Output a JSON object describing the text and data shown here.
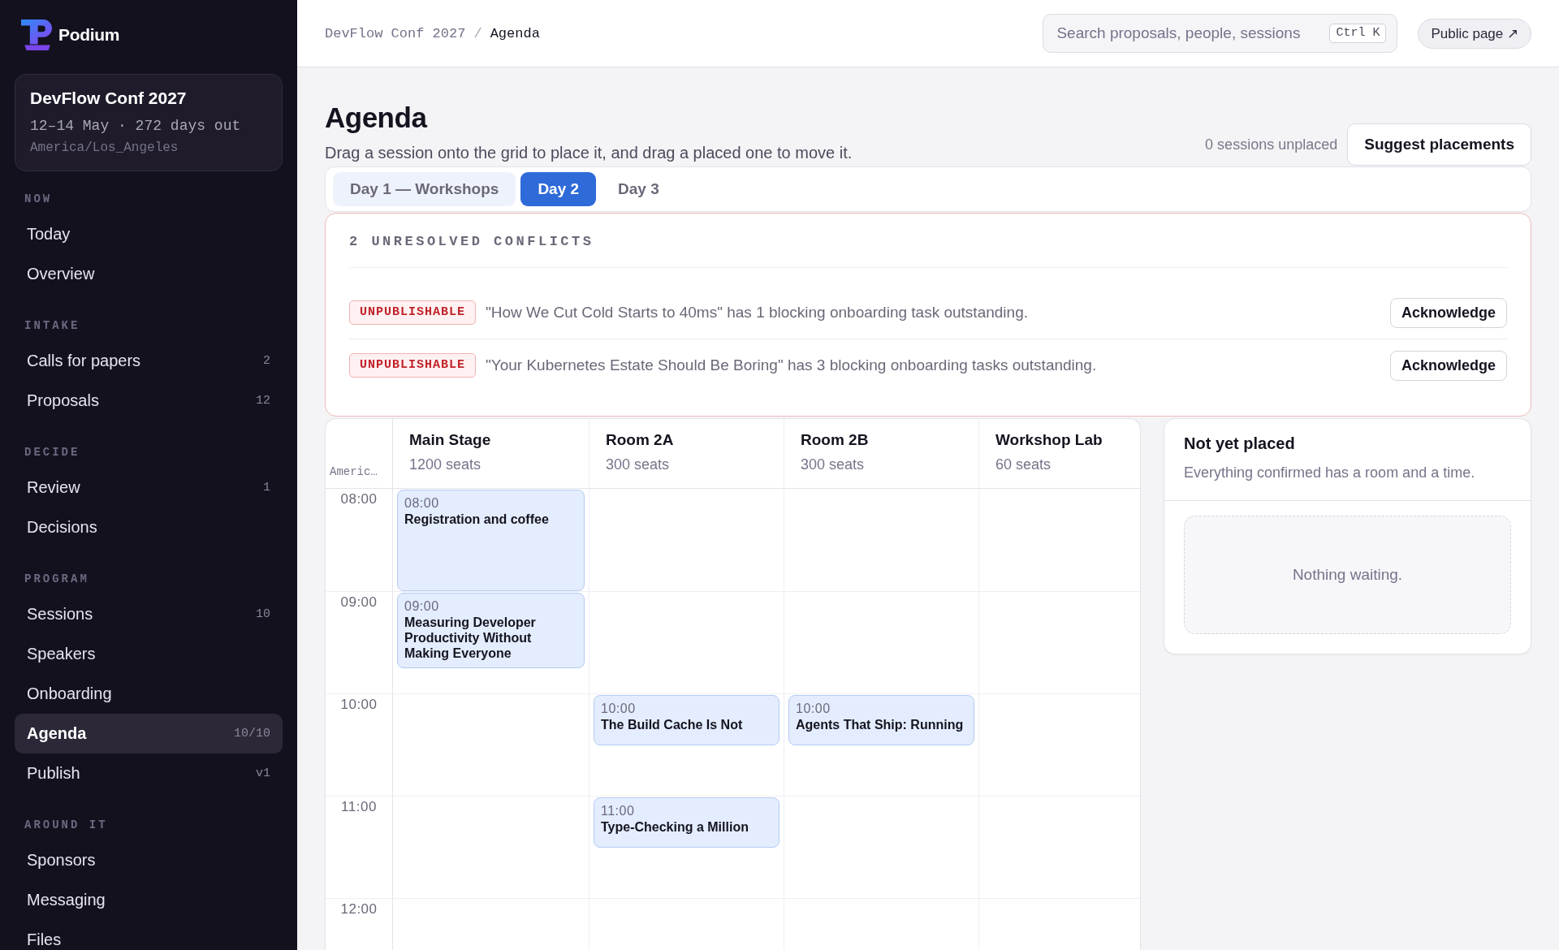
{
  "brand": {
    "name": "Podium"
  },
  "event": {
    "name": "DevFlow Conf 2027",
    "dates": "12–14 May · 272 days out",
    "timezone": "America/Los_Angeles"
  },
  "sidebar": {
    "sections": [
      {
        "title": "NOW",
        "items": [
          {
            "label": "Today",
            "selected": false
          },
          {
            "label": "Overview",
            "selected": false
          }
        ]
      },
      {
        "title": "INTAKE",
        "items": [
          {
            "label": "Calls for papers",
            "count": "2",
            "selected": false
          },
          {
            "label": "Proposals",
            "count": "12",
            "selected": false
          }
        ]
      },
      {
        "title": "DECIDE",
        "items": [
          {
            "label": "Review",
            "count": "1",
            "selected": false
          },
          {
            "label": "Decisions",
            "selected": false
          }
        ]
      },
      {
        "title": "PROGRAM",
        "items": [
          {
            "label": "Sessions",
            "count": "10",
            "selected": false
          },
          {
            "label": "Speakers",
            "selected": false
          },
          {
            "label": "Onboarding",
            "selected": false
          },
          {
            "label": "Agenda",
            "count": "10/10",
            "selected": true
          },
          {
            "label": "Publish",
            "count": "v1",
            "selected": false
          }
        ]
      },
      {
        "title": "AROUND IT",
        "items": [
          {
            "label": "Sponsors",
            "selected": false
          },
          {
            "label": "Messaging",
            "selected": false
          },
          {
            "label": "Files",
            "selected": false
          }
        ]
      }
    ]
  },
  "topbar": {
    "breadcrumb": [
      {
        "label": "DevFlow Conf 2027",
        "current": false
      },
      {
        "label": "Agenda",
        "current": true
      }
    ],
    "separator": "/",
    "search": {
      "placeholder": "Search proposals, people, sessions",
      "shortcut": "Ctrl K"
    },
    "public_link": "Public page ↗"
  },
  "page": {
    "title": "Agenda",
    "subtitle": "Drag a session onto the grid to place it, and drag a placed one to move it.",
    "unplaced": "0 sessions unplaced",
    "suggest_button": "Suggest placements"
  },
  "tabs": [
    {
      "label": "Day 1 — Workshops",
      "selected": false,
      "hovered": true
    },
    {
      "label": "Day 2",
      "selected": true,
      "hovered": false
    },
    {
      "label": "Day 3",
      "selected": false,
      "hovered": false
    }
  ],
  "conflicts": {
    "title": "2 UNRESOLVED CONFLICTS",
    "items": [
      {
        "badge": "UNPUBLISHABLE",
        "message": "\"How We Cut Cold Starts to 40ms\" has 1 blocking onboarding task outstanding.",
        "action": "Acknowledge"
      },
      {
        "badge": "UNPUBLISHABLE",
        "message": "\"Your Kubernetes Estate Should Be Boring\" has 3 blocking onboarding tasks outstanding.",
        "action": "Acknowledge"
      }
    ]
  },
  "grid": {
    "timezone": "Americ…",
    "rooms": [
      {
        "name": "Main Stage",
        "seats": "1200 seats"
      },
      {
        "name": "Room 2A",
        "seats": "300 seats"
      },
      {
        "name": "Room 2B",
        "seats": "300 seats"
      },
      {
        "name": "Workshop Lab",
        "seats": "60 seats"
      }
    ],
    "rows": [
      {
        "time": "08:00",
        "cells": [
          {
            "kind": "hour",
            "time": "08:00",
            "title": "Registration and coffee"
          },
          {
            "kind": "empty"
          },
          {
            "kind": "empty"
          },
          {
            "kind": "empty"
          }
        ]
      },
      {
        "time": "09:00",
        "cells": [
          {
            "kind": "three-quarter",
            "time": "09:00",
            "title": "Measuring Developer Productivity Without Making Everyone"
          },
          {
            "kind": "empty"
          },
          {
            "kind": "empty"
          },
          {
            "kind": "empty"
          }
        ]
      },
      {
        "time": "10:00",
        "cells": [
          {
            "kind": "empty"
          },
          {
            "kind": "half",
            "time": "10:00",
            "title": "The Build Cache Is Not"
          },
          {
            "kind": "half",
            "time": "10:00",
            "title": "Agents That Ship: Running"
          },
          {
            "kind": "empty"
          }
        ]
      },
      {
        "time": "11:00",
        "cells": [
          {
            "kind": "empty"
          },
          {
            "kind": "half",
            "time": "11:00",
            "title": "Type-Checking a Million"
          },
          {
            "kind": "empty"
          },
          {
            "kind": "empty"
          }
        ]
      },
      {
        "time": "12:00",
        "cells": [
          {
            "kind": "empty"
          },
          {
            "kind": "empty"
          },
          {
            "kind": "empty"
          },
          {
            "kind": "empty"
          }
        ]
      }
    ]
  },
  "unplaced_panel": {
    "title": "Not yet placed",
    "description": "Everything confirmed has a room and a time.",
    "empty_text": "Nothing waiting."
  }
}
